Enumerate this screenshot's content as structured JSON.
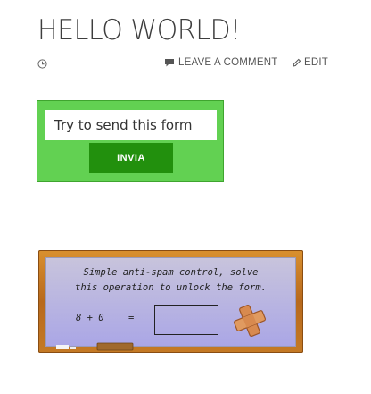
{
  "post": {
    "title": "HELLO WORLD!"
  },
  "meta": {
    "comment_label": "LEAVE A COMMENT",
    "edit_label": "EDIT",
    "icons": [
      "clock-icon",
      "comment-icon",
      "pencil-icon"
    ]
  },
  "form": {
    "input_value": "Try to send this form",
    "submit_label": "INVIA",
    "background_color": "#62d152",
    "button_color": "#22900d"
  },
  "antispam": {
    "line1": "Simple anti-spam control, solve",
    "line2": "this operation to unlock the form.",
    "equation": "8 + 0",
    "equals": "=",
    "answer_value": "",
    "icons": [
      "plus-icon"
    ]
  }
}
